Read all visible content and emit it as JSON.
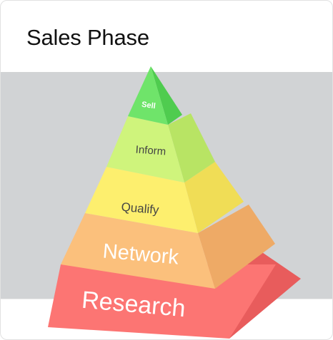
{
  "header": {
    "title": "Sales Phase"
  },
  "pyramid": {
    "levels": [
      {
        "label": "Sell",
        "color": "#6fe46a",
        "side_color": "#4fcc4f"
      },
      {
        "label": "Inform",
        "color": "#cff47c",
        "side_color": "#b8e464"
      },
      {
        "label": "Qualify",
        "color": "#fdef6e",
        "side_color": "#f0dd56"
      },
      {
        "label": "Network",
        "color": "#fbc07c",
        "side_color": "#eeaa66"
      },
      {
        "label": "Research",
        "color": "#fc7573",
        "side_color": "#e85c5c"
      }
    ]
  }
}
